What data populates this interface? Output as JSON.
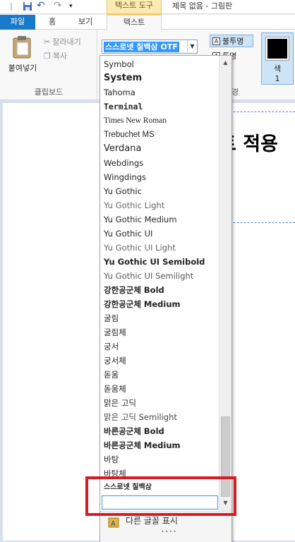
{
  "titlebar": {
    "contextual_tab": "텍스트 도구",
    "window_title": "제목 없음 - 그림판"
  },
  "tabs": {
    "file": "파일",
    "home": "홈",
    "view": "보기",
    "text": "텍스트"
  },
  "clipboard": {
    "paste": "붙여넣기",
    "cut": "잘라내기",
    "copy": "복사",
    "group_label": "클립보드"
  },
  "font": {
    "current": "스스로넷 칠백삼 OTF"
  },
  "background": {
    "opaque": "불투명",
    "transparent": "투명",
    "group_label_fragment": "경"
  },
  "colors": {
    "color1_label": "색\n1",
    "color1_value": "#000000"
  },
  "canvas": {
    "text_fragment": "트 적용"
  },
  "font_list": {
    "items": [
      "Symbol",
      "System",
      "Tahoma",
      "Terminal",
      "Times New Roman",
      "Trebuchet MS",
      "Verdana",
      "Webdings",
      "Wingdings",
      "Yu Gothic",
      "Yu Gothic Light",
      "Yu Gothic Medium",
      "Yu Gothic UI",
      "Yu Gothic UI Light",
      "Yu Gothic UI Semibold",
      "Yu Gothic UI Semilight",
      "강한공군체 Bold",
      "강한공군체 Medium",
      "굴림",
      "굴림체",
      "궁서",
      "궁서체",
      "돋움",
      "돋움체",
      "맑은 고딕",
      "맑은 고딕 Semilight",
      "바른공군체 Bold",
      "바른공군체 Medium",
      "바탕",
      "바탕체",
      "스스로넷 칠백삼",
      "스스로넷 칠백삼 OTF"
    ],
    "more_fonts": "다른 글꼴 표시"
  },
  "accent_colors": {
    "file_tab": "#1979ca",
    "contextual": "#fbeab2",
    "highlight": "#d91c24",
    "selection": "#3399ff"
  }
}
